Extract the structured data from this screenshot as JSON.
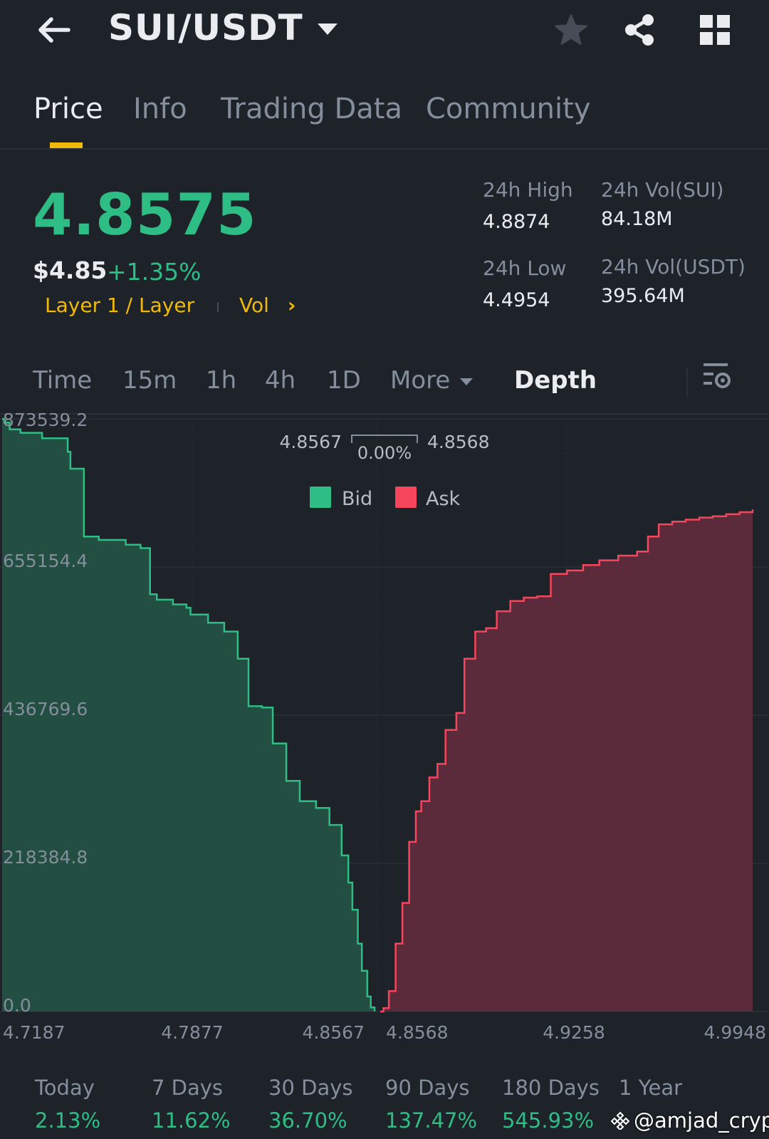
{
  "header": {
    "pair": "SUI/USDT",
    "icons": [
      "back-arrow-icon",
      "star-icon",
      "share-icon",
      "grid-icon"
    ]
  },
  "tabs": [
    {
      "label": "Price",
      "active": true
    },
    {
      "label": "Info",
      "active": false
    },
    {
      "label": "Trading Data",
      "active": false
    },
    {
      "label": "Community",
      "active": false
    }
  ],
  "ticker": {
    "last_price": "4.8575",
    "usd_price": "$4.85",
    "change": "+1.35%",
    "tag": "Layer 1 / Layer",
    "vol_link": "Vol",
    "vol_chevron": "›"
  },
  "stats": {
    "high_label": "24h High",
    "high": "4.8874",
    "low_label": "24h Low",
    "low": "4.4954",
    "vol_sui_label": "24h Vol(SUI)",
    "vol_sui": "84.18M",
    "vol_usdt_label": "24h Vol(USDT)",
    "vol_usdt": "395.64M"
  },
  "timeframes": [
    {
      "label": "Time"
    },
    {
      "label": "15m"
    },
    {
      "label": "1h"
    },
    {
      "label": "4h"
    },
    {
      "label": "1D"
    },
    {
      "label": "More"
    },
    {
      "label": "Depth",
      "active": true
    }
  ],
  "chart_data": {
    "type": "area",
    "yticks": [
      "873539.2",
      "655154.4",
      "436769.6",
      "218384.8",
      "0.0"
    ],
    "xticks": [
      "4.7187",
      "4.7877",
      "4.8567",
      "4.8568",
      "4.9258",
      "4.9948"
    ],
    "ylim": [
      0,
      873539.2
    ],
    "xlim": [
      4.7187,
      4.9948
    ],
    "best_bid": "4.8567",
    "best_ask": "4.8568",
    "spread": "0.00%",
    "legend": [
      "Bid",
      "Ask"
    ],
    "grid": true,
    "colors": {
      "bid": "#2ebd85",
      "ask": "#f6465d",
      "bid_fill": "#234f43",
      "ask_fill": "#5b2b3c"
    },
    "series": [
      {
        "name": "Bid",
        "x": [
          4.7187,
          4.7195,
          4.7215,
          4.7255,
          4.7335,
          4.743,
          4.744,
          4.749,
          4.7545,
          4.7645,
          4.77,
          4.7735,
          4.776,
          4.782,
          4.787,
          4.7885,
          4.795,
          4.801,
          4.806,
          4.81,
          4.815,
          4.819,
          4.824,
          4.829,
          4.835,
          4.84,
          4.8445,
          4.847,
          4.8485,
          4.8505,
          4.852,
          4.854,
          4.8553,
          4.8567
        ],
        "y": [
          873539.2,
          868000,
          858000,
          853000,
          845000,
          825000,
          800000,
          700000,
          695000,
          688000,
          683000,
          615000,
          607000,
          600000,
          595000,
          585000,
          573000,
          560000,
          520000,
          450000,
          448000,
          395000,
          340000,
          310000,
          300000,
          275000,
          230000,
          190000,
          150000,
          100000,
          60000,
          22000,
          6000,
          0
        ]
      },
      {
        "name": "Ask",
        "x": [
          4.8568,
          4.858,
          4.86,
          4.8625,
          4.865,
          4.8675,
          4.87,
          4.872,
          4.875,
          4.878,
          4.881,
          4.885,
          4.888,
          4.892,
          4.896,
          4.9,
          4.905,
          4.91,
          4.915,
          4.92,
          4.926,
          4.932,
          4.938,
          4.945,
          4.952,
          4.956,
          4.96,
          4.965,
          4.97,
          4.975,
          4.98,
          4.985,
          4.99,
          4.9948
        ],
        "y": [
          0,
          5000,
          30000,
          100000,
          160000,
          250000,
          295000,
          310000,
          345000,
          365000,
          415000,
          440000,
          520000,
          560000,
          565000,
          590000,
          605000,
          610000,
          612000,
          645000,
          650000,
          658000,
          665000,
          672000,
          678000,
          700000,
          718000,
          722000,
          725000,
          728000,
          730000,
          733000,
          736000,
          740000
        ]
      }
    ]
  },
  "performance": [
    {
      "label": "Today",
      "value": "2.13%"
    },
    {
      "label": "7 Days",
      "value": "11.62%"
    },
    {
      "label": "30 Days",
      "value": "36.70%"
    },
    {
      "label": "90 Days",
      "value": "137.47%"
    },
    {
      "label": "180 Days",
      "value": "545.93%"
    },
    {
      "label": "1 Year",
      "value": ""
    }
  ],
  "watermark": "@amjad_crypto"
}
